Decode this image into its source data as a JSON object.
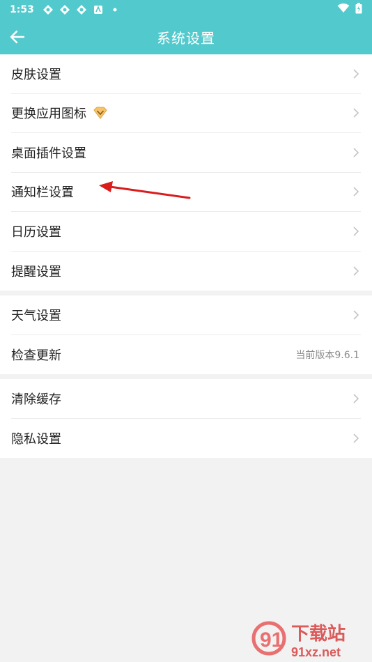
{
  "status_bar": {
    "time": "1:53"
  },
  "app_bar": {
    "title": "系统设置"
  },
  "groups": [
    {
      "items": [
        {
          "label": "皮肤设置"
        },
        {
          "label": "更换应用图标"
        },
        {
          "label": "桌面插件设置"
        },
        {
          "label": "通知栏设置"
        },
        {
          "label": "日历设置"
        },
        {
          "label": "提醒设置"
        }
      ]
    },
    {
      "items": [
        {
          "label": "天气设置"
        },
        {
          "label": "检查更新",
          "value": "当前版本9.6.1"
        }
      ]
    },
    {
      "items": [
        {
          "label": "清除缓存"
        },
        {
          "label": "隐私设置"
        }
      ]
    }
  ],
  "watermark": {
    "main": "下载站",
    "domain": "91xz.net",
    "logo": "91"
  },
  "colors": {
    "accent": "#52c9cc",
    "annotation_arrow": "#e02020"
  }
}
